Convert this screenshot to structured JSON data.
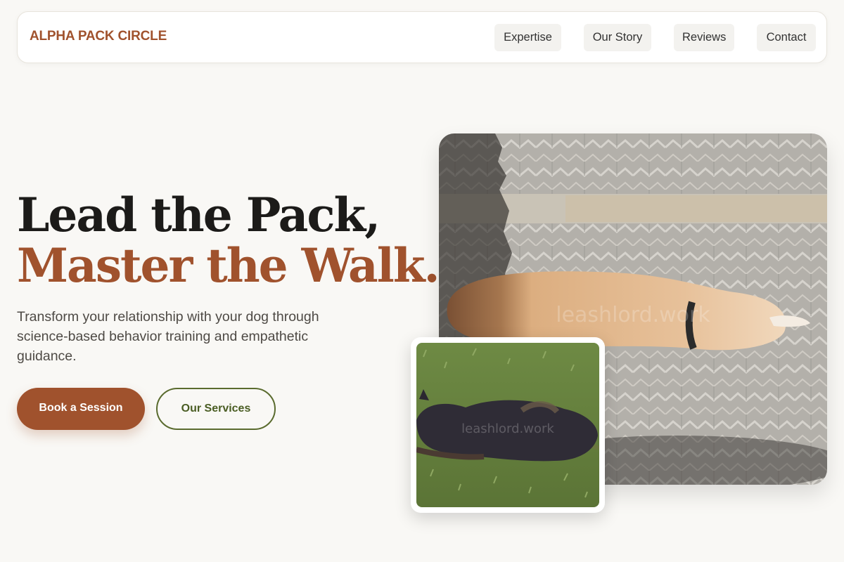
{
  "nav": {
    "brand": "ALPHA PACK CIRCLE",
    "links": [
      "Expertise",
      "Our Story",
      "Reviews",
      "Contact"
    ]
  },
  "hero": {
    "headline_line1": "Lead the Pack,",
    "headline_line2": "Master the Walk.",
    "subtext": "Transform your relationship with your dog through science-based behavior training and empathetic guidance.",
    "primary_cta": "Book a Session",
    "secondary_cta": "Our Services"
  },
  "images": {
    "main_watermark": "leashlord.work",
    "small_watermark": "leashlord.work"
  },
  "colors": {
    "accent": "#a0522d",
    "secondary": "#4a5d23",
    "background": "#f9f8f5",
    "text": "#1c1b19"
  }
}
